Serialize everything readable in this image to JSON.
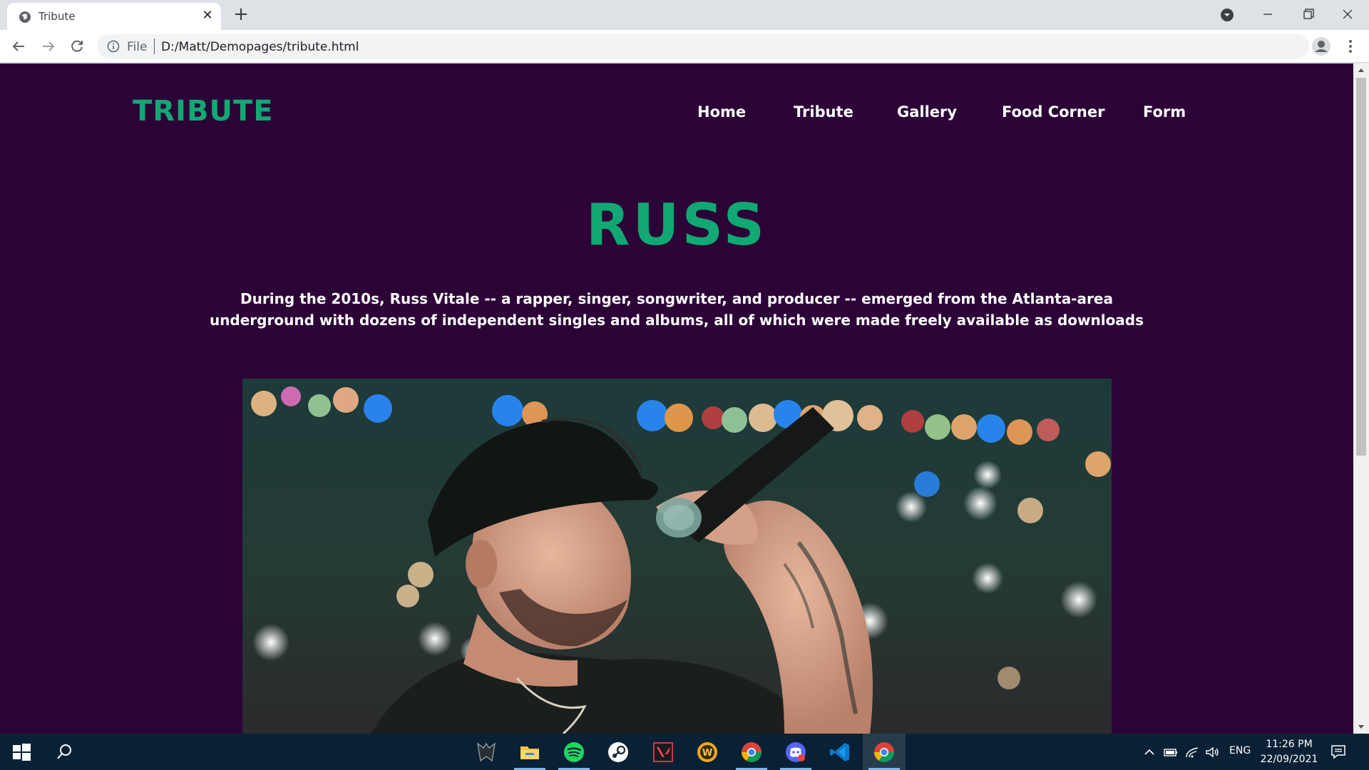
{
  "browser": {
    "tab_title": "Tribute",
    "url_scheme": "File",
    "url": "D:/Matt/Demopages/tribute.html"
  },
  "page": {
    "logo": "TRIBUTE",
    "nav": [
      "Home",
      "Tribute",
      "Gallery",
      "Food Corner",
      "Form"
    ],
    "hero_title": "RUSS",
    "hero_text": "During the 2010s, Russ Vitale -- a rapper, singer, songwriter, and producer -- emerged from the Atlanta-area underground with dozens of independent singles and albums, all of which were made freely available as downloads",
    "colors": {
      "background": "#2c0337",
      "accent": "#12a873",
      "text": "#ffffff"
    }
  },
  "taskbar": {
    "apps": [
      "acer-predator-icon",
      "file-explorer-icon",
      "spotify-icon",
      "steam-icon",
      "valorant-icon",
      "world-of-warcraft-icon",
      "chrome-alt-icon",
      "discord-icon",
      "vscode-icon",
      "chrome-icon"
    ],
    "language": "ENG",
    "time": "11:26 PM",
    "date": "22/09/2021"
  }
}
